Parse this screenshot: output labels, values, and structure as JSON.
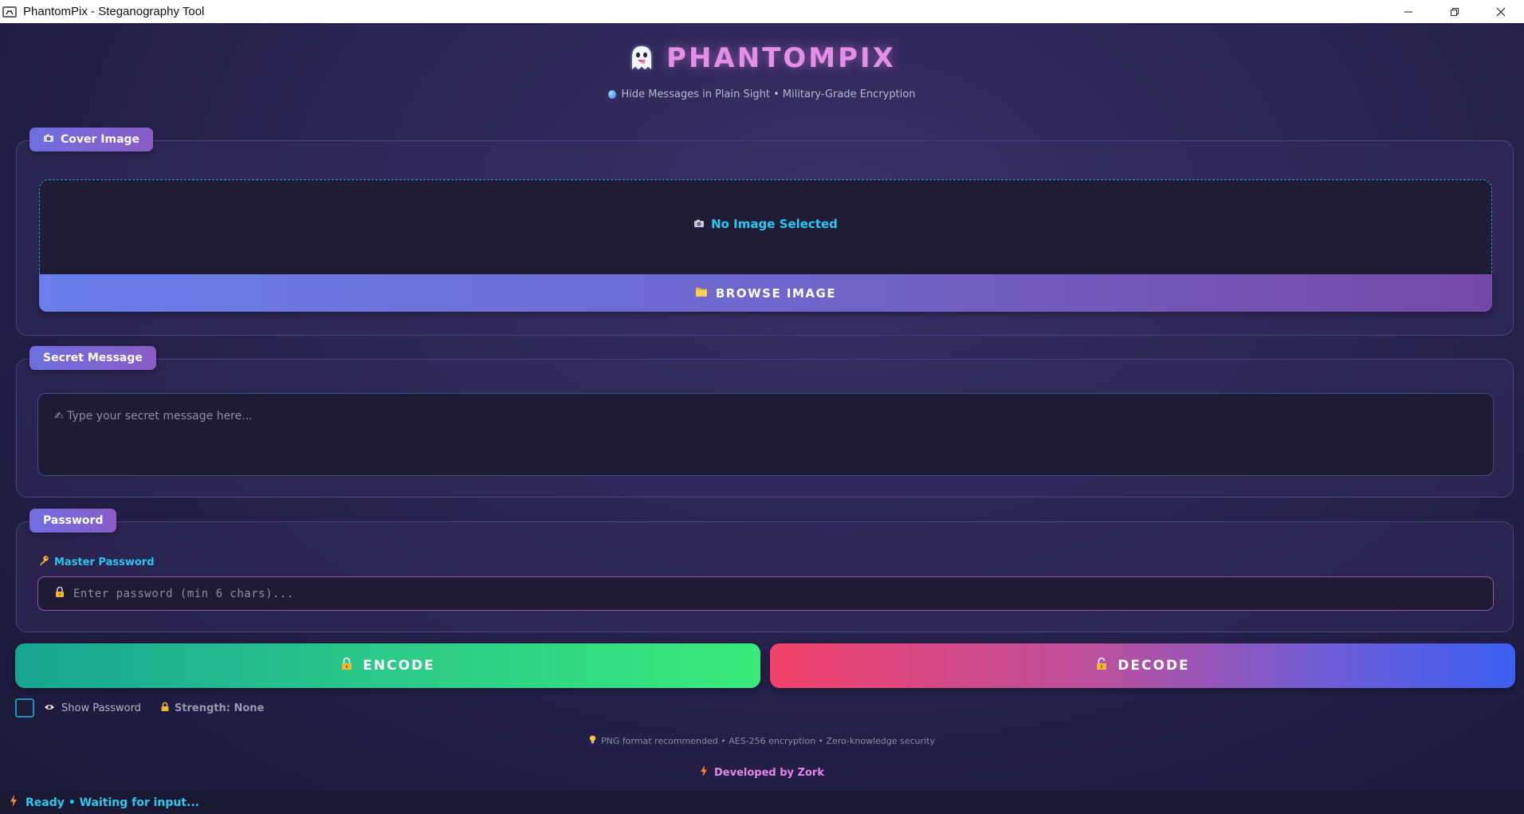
{
  "window": {
    "title": "PhantomPix - Steganography Tool",
    "controls": [
      "minimize",
      "restore",
      "close"
    ]
  },
  "header": {
    "emoji": "👻",
    "title": "PHANTOMPIX",
    "tagline": "Hide Messages in Plain Sight • Military-Grade Encryption"
  },
  "cover_image": {
    "label": "Cover Image",
    "status": "No Image Selected",
    "browse_label": "BROWSE IMAGE"
  },
  "secret_message": {
    "label": "Secret Message",
    "placeholder": "✍ Type your secret message here..."
  },
  "password": {
    "label": "Password",
    "field_label": "Master Password",
    "placeholder": "Enter password (min 6 chars)..."
  },
  "actions": {
    "encode_label": "ENCODE",
    "decode_label": "DECODE"
  },
  "options": {
    "show_password_label": "Show Password",
    "show_password_checked": false,
    "strength_label": "Strength: None"
  },
  "footer": {
    "note": "PNG format recommended • AES-256 encryption • Zero-knowledge security",
    "credit": "Developed by Zork"
  },
  "status": {
    "text": "Ready • Waiting for input..."
  },
  "colors": {
    "accent_cyan": "#27c5ef",
    "accent_pink": "#e38fe6",
    "encode_start": "#17a591",
    "encode_end": "#3aea7a",
    "decode_start": "#f3416a",
    "decode_end": "#3c5ff2"
  }
}
